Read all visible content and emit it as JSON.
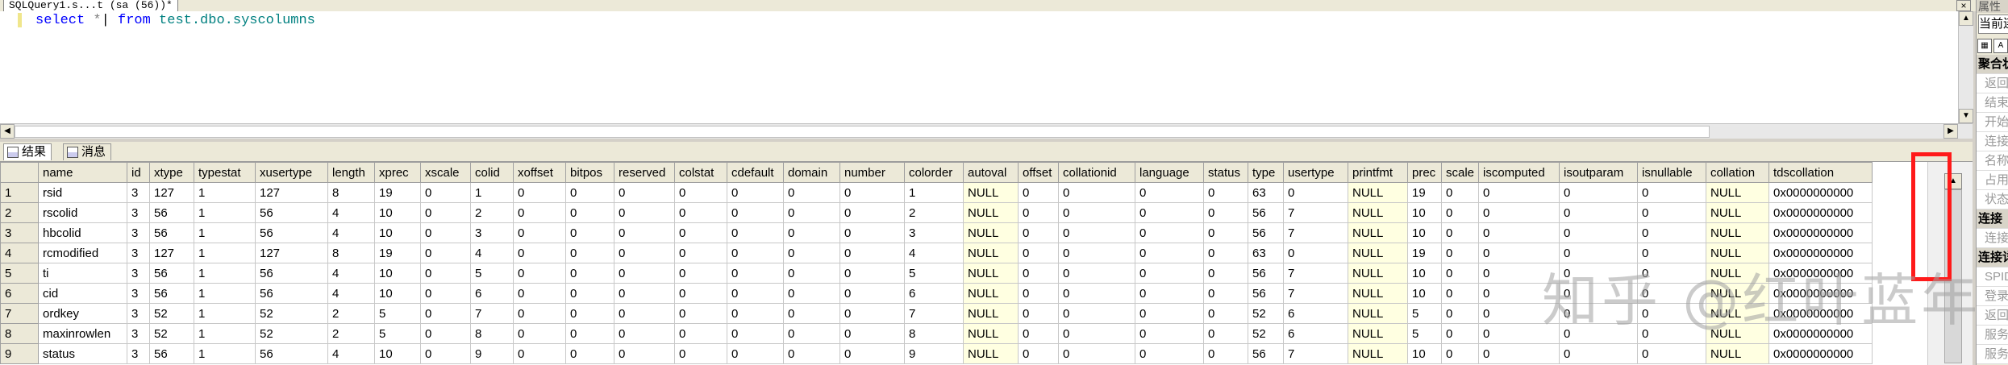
{
  "editor": {
    "tab_title": "SQLQuery1.s...t (sa (56))*",
    "close_symbol": "×",
    "query": {
      "select": "select",
      "star": "*",
      "from": "from",
      "table": "test.dbo.syscolumns"
    }
  },
  "result_tabs": [
    {
      "label": "结果"
    },
    {
      "label": "消息"
    }
  ],
  "grid": {
    "columns": [
      "name",
      "id",
      "xtype",
      "typestat",
      "xusertype",
      "length",
      "xprec",
      "xscale",
      "colid",
      "xoffset",
      "bitpos",
      "reserved",
      "colstat",
      "cdefault",
      "domain",
      "number",
      "colorder",
      "autoval",
      "offset",
      "collationid",
      "language",
      "status",
      "type",
      "usertype",
      "printfmt",
      "prec",
      "scale",
      "iscomputed",
      "isoutparam",
      "isnullable",
      "collation",
      "tdscollation"
    ],
    "rows": [
      [
        "1",
        "rsid",
        "3",
        "127",
        "1",
        "127",
        "8",
        "19",
        "0",
        "1",
        "0",
        "0",
        "0",
        "0",
        "0",
        "0",
        "0",
        "1",
        "NULL",
        "0",
        "0",
        "0",
        "0",
        "63",
        "0",
        "NULL",
        "19",
        "0",
        "0",
        "0",
        "0",
        "NULL",
        "0x0000000000"
      ],
      [
        "2",
        "rscolid",
        "3",
        "56",
        "1",
        "56",
        "4",
        "10",
        "0",
        "2",
        "0",
        "0",
        "0",
        "0",
        "0",
        "0",
        "0",
        "2",
        "NULL",
        "0",
        "0",
        "0",
        "0",
        "56",
        "7",
        "NULL",
        "10",
        "0",
        "0",
        "0",
        "0",
        "NULL",
        "0x0000000000"
      ],
      [
        "3",
        "hbcolid",
        "3",
        "56",
        "1",
        "56",
        "4",
        "10",
        "0",
        "3",
        "0",
        "0",
        "0",
        "0",
        "0",
        "0",
        "0",
        "3",
        "NULL",
        "0",
        "0",
        "0",
        "0",
        "56",
        "7",
        "NULL",
        "10",
        "0",
        "0",
        "0",
        "0",
        "NULL",
        "0x0000000000"
      ],
      [
        "4",
        "rcmodified",
        "3",
        "127",
        "1",
        "127",
        "8",
        "19",
        "0",
        "4",
        "0",
        "0",
        "0",
        "0",
        "0",
        "0",
        "0",
        "4",
        "NULL",
        "0",
        "0",
        "0",
        "0",
        "63",
        "0",
        "NULL",
        "19",
        "0",
        "0",
        "0",
        "0",
        "NULL",
        "0x0000000000"
      ],
      [
        "5",
        "ti",
        "3",
        "56",
        "1",
        "56",
        "4",
        "10",
        "0",
        "5",
        "0",
        "0",
        "0",
        "0",
        "0",
        "0",
        "0",
        "5",
        "NULL",
        "0",
        "0",
        "0",
        "0",
        "56",
        "7",
        "NULL",
        "10",
        "0",
        "0",
        "0",
        "0",
        "NULL",
        "0x0000000000"
      ],
      [
        "6",
        "cid",
        "3",
        "56",
        "1",
        "56",
        "4",
        "10",
        "0",
        "6",
        "0",
        "0",
        "0",
        "0",
        "0",
        "0",
        "0",
        "6",
        "NULL",
        "0",
        "0",
        "0",
        "0",
        "56",
        "7",
        "NULL",
        "10",
        "0",
        "0",
        "0",
        "0",
        "NULL",
        "0x0000000000"
      ],
      [
        "7",
        "ordkey",
        "3",
        "52",
        "1",
        "52",
        "2",
        "5",
        "0",
        "7",
        "0",
        "0",
        "0",
        "0",
        "0",
        "0",
        "0",
        "7",
        "NULL",
        "0",
        "0",
        "0",
        "0",
        "52",
        "6",
        "NULL",
        "5",
        "0",
        "0",
        "0",
        "0",
        "NULL",
        "0x0000000000"
      ],
      [
        "8",
        "maxinrowlen",
        "3",
        "52",
        "1",
        "52",
        "2",
        "5",
        "0",
        "8",
        "0",
        "0",
        "0",
        "0",
        "0",
        "0",
        "0",
        "8",
        "NULL",
        "0",
        "0",
        "0",
        "0",
        "52",
        "6",
        "NULL",
        "5",
        "0",
        "0",
        "0",
        "0",
        "NULL",
        "0x0000000000"
      ],
      [
        "9",
        "status",
        "3",
        "56",
        "1",
        "56",
        "4",
        "10",
        "0",
        "9",
        "0",
        "0",
        "0",
        "0",
        "0",
        "0",
        "0",
        "9",
        "NULL",
        "0",
        "0",
        "0",
        "0",
        "56",
        "7",
        "NULL",
        "10",
        "0",
        "0",
        "0",
        "0",
        "NULL",
        "0x0000000000"
      ]
    ]
  },
  "watermark": "知乎 @红叶蓝年",
  "properties_panel": {
    "title": "属性",
    "combo": "当前连",
    "rows": [
      {
        "label": "聚合状",
        "category": true
      },
      {
        "label": "返回的",
        "category": false
      },
      {
        "label": "结束时",
        "category": false
      },
      {
        "label": "开始时",
        "category": false
      },
      {
        "label": "连接失",
        "category": false
      },
      {
        "label": "名称",
        "category": false
      },
      {
        "label": "占用时",
        "category": false
      },
      {
        "label": "状态",
        "category": false
      },
      {
        "label": "连接",
        "category": true
      },
      {
        "label": "连接名",
        "category": false
      },
      {
        "label": "连接详",
        "category": true
      },
      {
        "label": "SPID",
        "category": false
      },
      {
        "label": "登录名",
        "category": false
      },
      {
        "label": "返回的",
        "category": false
      },
      {
        "label": "服务器",
        "category": false
      },
      {
        "label": "服务器",
        "category": false
      }
    ]
  },
  "colors": {
    "null_cell": "#ffffe1",
    "highlight": "#ff1a1a",
    "keyword": "#0000ff",
    "table_name": "#008080"
  }
}
